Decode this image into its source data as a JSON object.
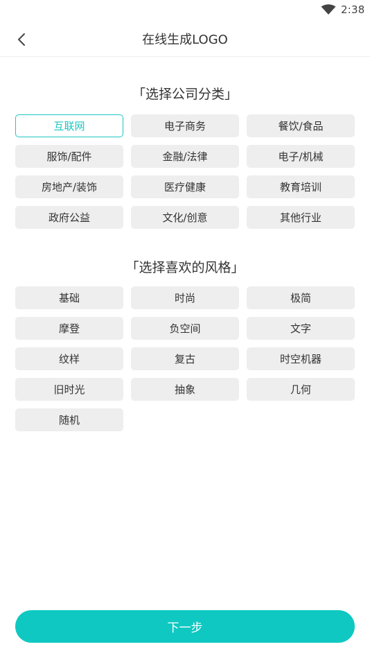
{
  "status_bar": {
    "time": "2:38"
  },
  "header": {
    "title": "在线生成LOGO"
  },
  "category_section": {
    "title": "「选择公司分类」",
    "items": [
      {
        "label": "互联网",
        "selected": true
      },
      {
        "label": "电子商务",
        "selected": false
      },
      {
        "label": "餐饮/食品",
        "selected": false
      },
      {
        "label": "服饰/配件",
        "selected": false
      },
      {
        "label": "金融/法律",
        "selected": false
      },
      {
        "label": "电子/机械",
        "selected": false
      },
      {
        "label": "房地产/装饰",
        "selected": false
      },
      {
        "label": "医疗健康",
        "selected": false
      },
      {
        "label": "教育培训",
        "selected": false
      },
      {
        "label": "政府公益",
        "selected": false
      },
      {
        "label": "文化/创意",
        "selected": false
      },
      {
        "label": "其他行业",
        "selected": false
      }
    ]
  },
  "style_section": {
    "title": "「选择喜欢的风格」",
    "items": [
      {
        "label": "基础"
      },
      {
        "label": "时尚"
      },
      {
        "label": "极简"
      },
      {
        "label": "摩登"
      },
      {
        "label": "负空间"
      },
      {
        "label": "文字"
      },
      {
        "label": "纹样"
      },
      {
        "label": "复古"
      },
      {
        "label": "时空机器"
      },
      {
        "label": "旧时光"
      },
      {
        "label": "抽象"
      },
      {
        "label": "几何"
      },
      {
        "label": "随机"
      }
    ]
  },
  "next_button": {
    "label": "下一步"
  },
  "colors": {
    "accent": "#0fc8c2",
    "chip_bg": "#eeeeee",
    "selected_border": "#1bc7c1"
  }
}
